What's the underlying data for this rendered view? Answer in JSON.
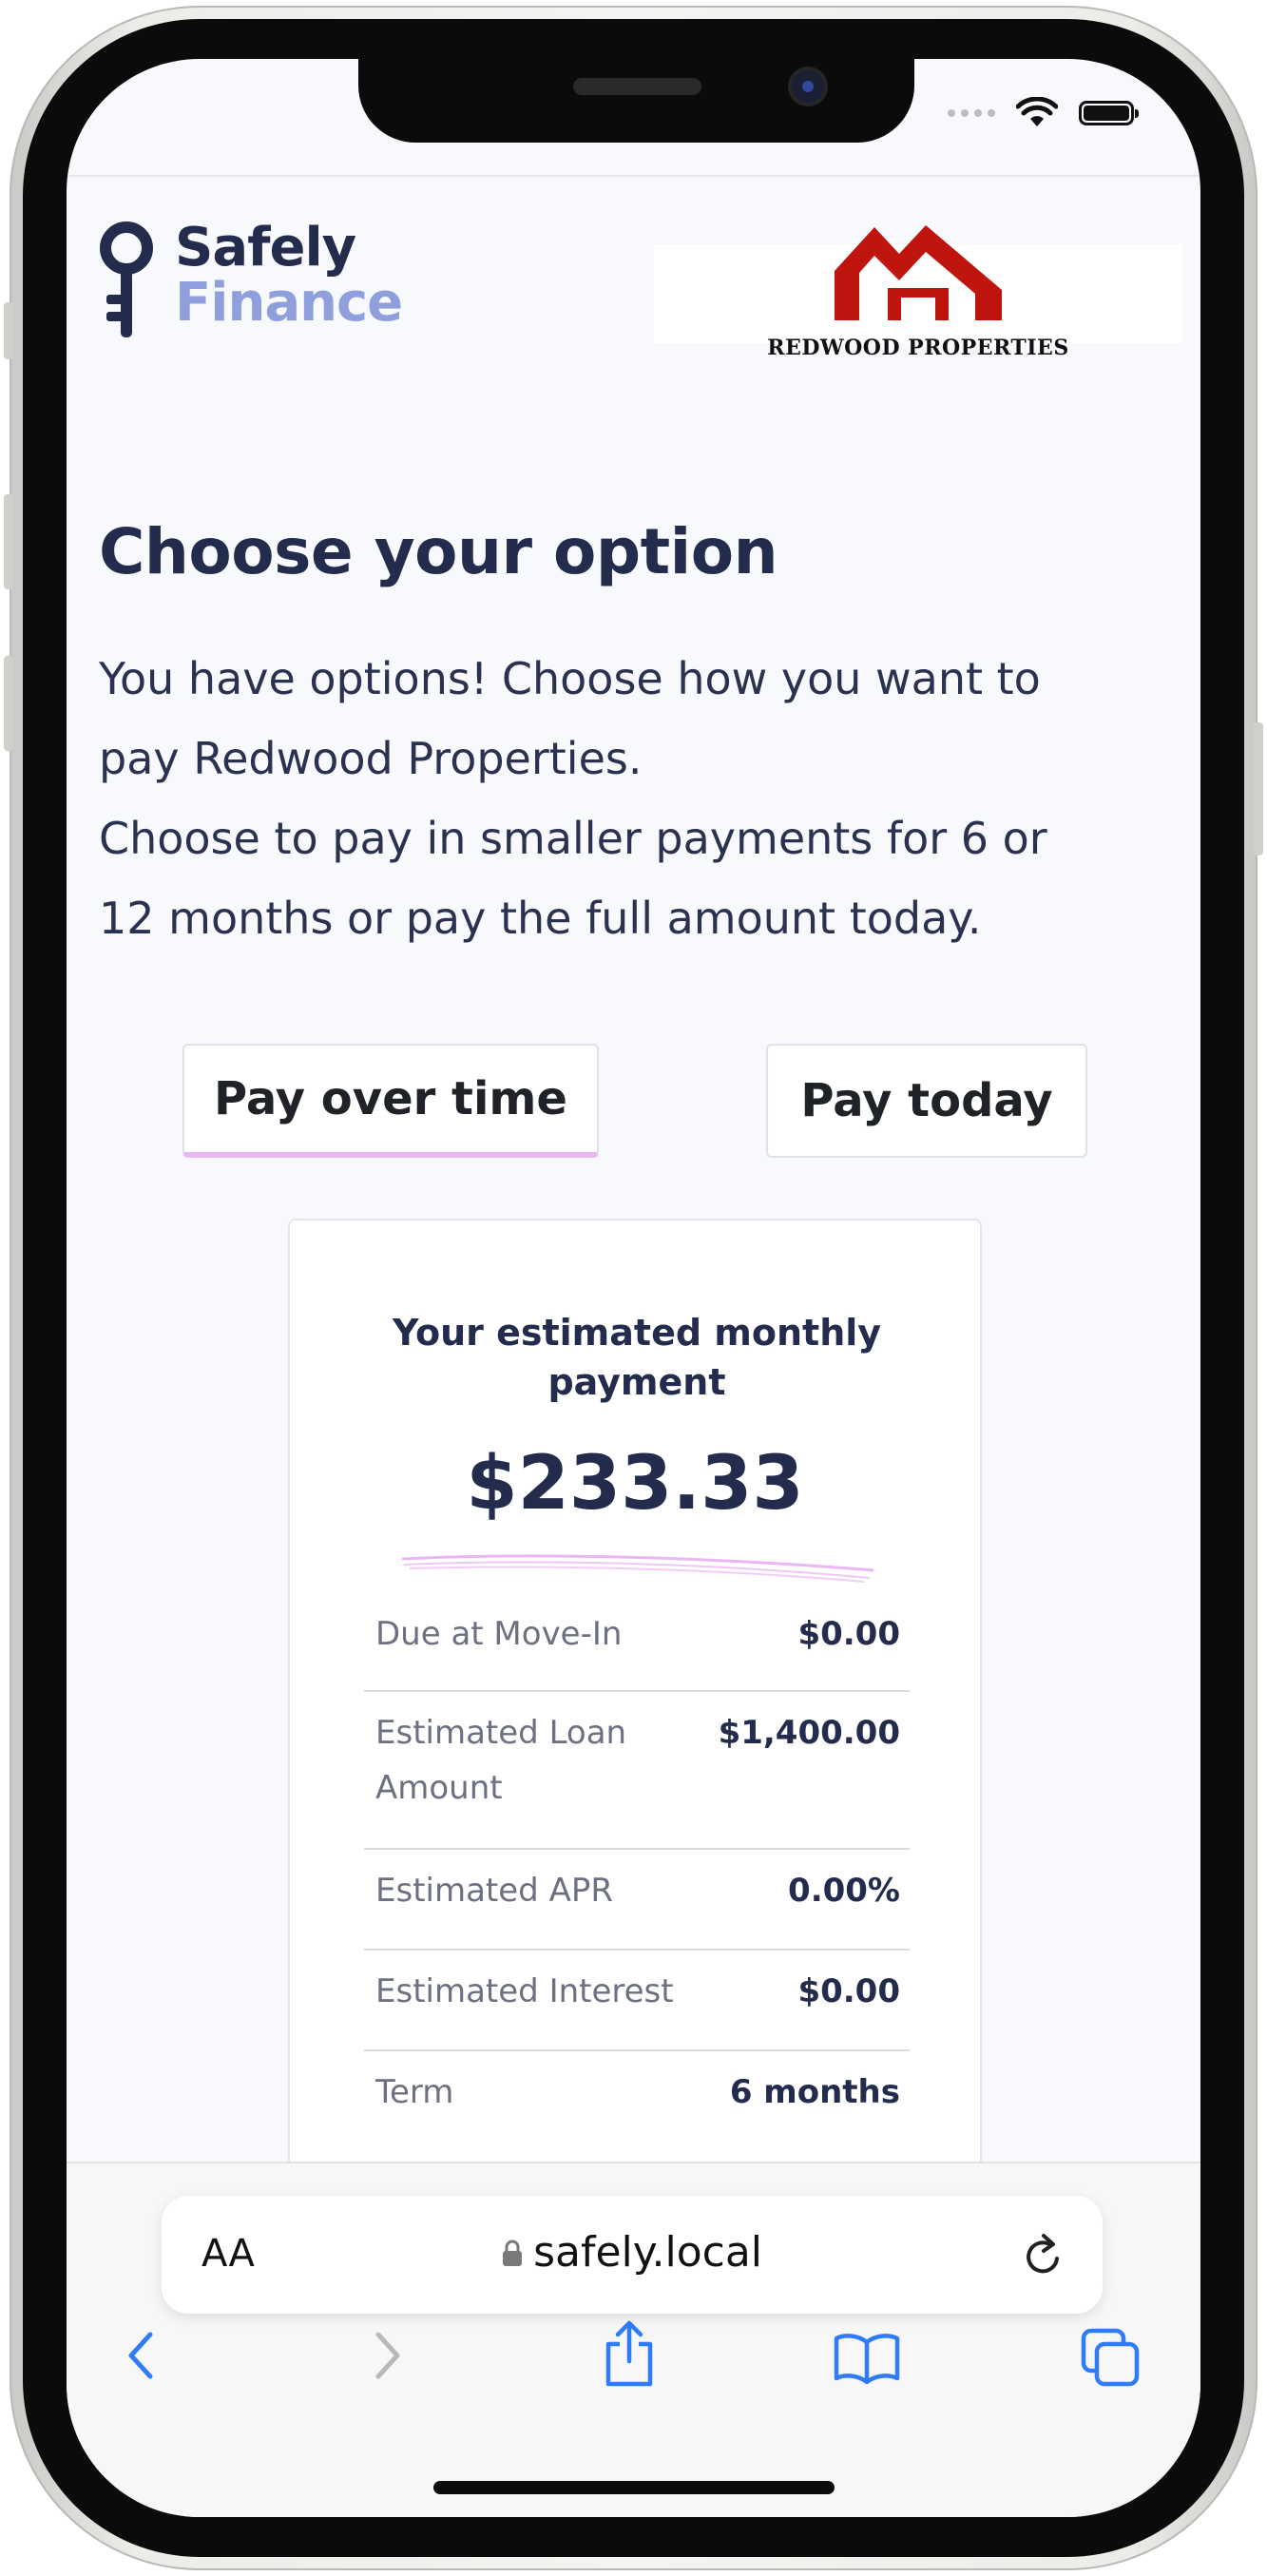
{
  "header": {
    "logo_line1": "Safely",
    "logo_line2": "Finance",
    "partner_name": "REDWOOD PROPERTIES"
  },
  "main": {
    "title": "Choose your option",
    "intro_line1": "You have options! Choose how you want to",
    "intro_line2": "pay Redwood Properties.",
    "intro_line3": "Choose to pay in smaller payments for 6 or",
    "intro_line4": "12 months or pay the full amount today.",
    "options": [
      {
        "label": "Pay over time",
        "active": true
      },
      {
        "label": "Pay today",
        "active": false
      }
    ]
  },
  "card": {
    "label": "Your estimated monthly payment",
    "amount": "$233.33",
    "rows": [
      {
        "label": "Due at Move-In",
        "value": "$0.00"
      },
      {
        "label": "Estimated Loan Amount",
        "value": "$1,400.00"
      },
      {
        "label": "Estimated APR",
        "value": "0.00%"
      },
      {
        "label": "Estimated Interest",
        "value": "$0.00"
      },
      {
        "label": "Term",
        "value": "6 months"
      }
    ]
  },
  "browser": {
    "text_size_label": "AA",
    "url": "safely.local"
  },
  "colors": {
    "navy": "#232c4c",
    "finance_blue": "#8f9fdc",
    "accent_pink": "#e9b8f2",
    "brand_red": "#c0140f",
    "ios_blue": "#2f7cf6"
  },
  "icons": {
    "status": [
      "cellular-icon",
      "wifi-icon",
      "battery-icon"
    ],
    "toolbar": [
      "back-icon",
      "forward-icon",
      "share-icon",
      "bookmarks-icon",
      "tabs-icon"
    ]
  }
}
